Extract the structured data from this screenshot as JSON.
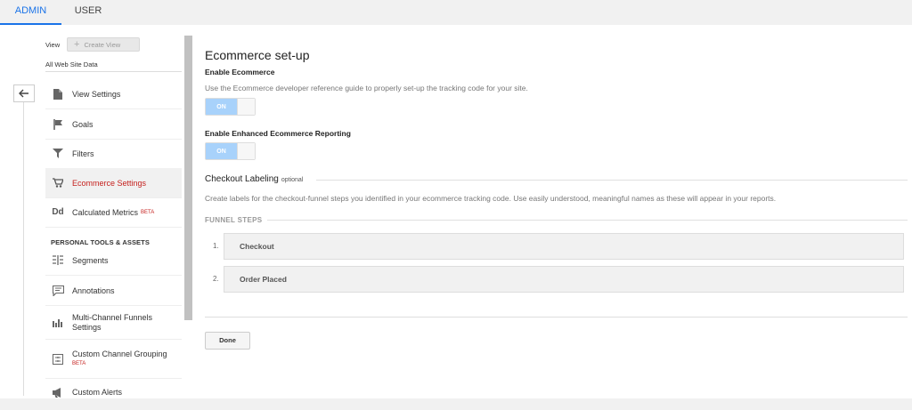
{
  "tabs": {
    "admin": "ADMIN",
    "user": "USER"
  },
  "nav": {
    "view_label": "View",
    "create_view": "Create View",
    "site_name": "All Web Site Data",
    "items": [
      {
        "label": "View Settings",
        "icon": "document-icon"
      },
      {
        "label": "Goals",
        "icon": "flag-icon"
      },
      {
        "label": "Filters",
        "icon": "filter-icon"
      },
      {
        "label": "Ecommerce Settings",
        "icon": "cart-icon"
      },
      {
        "label": "Calculated Metrics",
        "icon": "dd-icon",
        "badge": "BETA"
      }
    ],
    "section_title": "PERSONAL TOOLS & ASSETS",
    "tools": [
      {
        "label": "Segments",
        "icon": "segments-icon"
      },
      {
        "label": "Annotations",
        "icon": "annotation-icon"
      },
      {
        "label": "Multi-Channel Funnels Settings",
        "icon": "bar-chart-icon"
      },
      {
        "label": "Custom Channel Grouping",
        "icon": "channel-grouping-icon",
        "badge": "BETA"
      },
      {
        "label": "Custom Alerts",
        "icon": "megaphone-icon"
      }
    ]
  },
  "main": {
    "title": "Ecommerce set-up",
    "enable_ecommerce": {
      "label": "Enable Ecommerce",
      "description": "Use the Ecommerce developer reference guide to properly set-up the tracking code for your site.",
      "toggle": "ON"
    },
    "enhanced": {
      "label": "Enable Enhanced Ecommerce Reporting",
      "toggle": "ON"
    },
    "checkout": {
      "title": "Checkout Labeling",
      "optional": "optional",
      "description": "Create labels for the checkout-funnel steps you identified in your ecommerce tracking code. Use easily understood, meaningful names as these will appear in your reports."
    },
    "funnel_steps_title": "FUNNEL STEPS",
    "steps": [
      {
        "num": "1.",
        "label": "Checkout"
      },
      {
        "num": "2.",
        "label": "Order Placed"
      }
    ],
    "done": "Done"
  },
  "colors": {
    "accent": "#1a73e8",
    "active_red": "#c5221f",
    "toggle_on": "#a8d2fb"
  }
}
